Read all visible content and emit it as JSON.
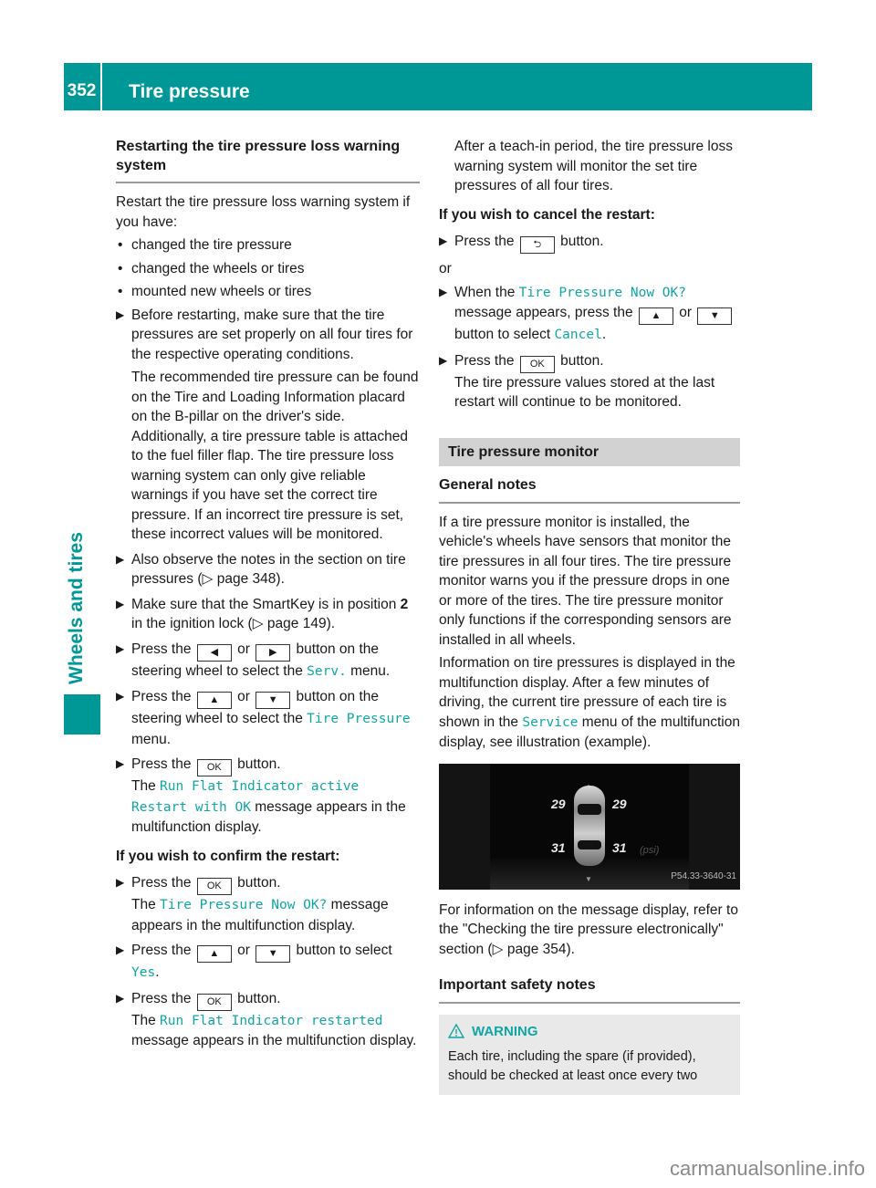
{
  "header": {
    "page_number": "352",
    "title": "Tire pressure"
  },
  "sidebar": {
    "chapter_label": "Wheels and tires",
    "accent_color": "#009896"
  },
  "left": {
    "section_title": "Restarting the tire pressure loss warning system",
    "intro": "Restart the tire pressure loss warning system if you have:",
    "bullets": [
      "changed the tire pressure",
      "changed the wheels or tires",
      "mounted new wheels or tires"
    ],
    "step1": {
      "text": "Before restarting, make sure that the tire pressures are set properly on all four tires for the respective operating conditions.",
      "note": "The recommended tire pressure can be found on the Tire and Loading Information placard on the B-pillar on the driver's side. Additionally, a tire pressure table is attached to the fuel filler flap. The tire pressure loss warning system can only give reliable warnings if you have set the correct tire pressure. If an incorrect tire pressure is set, these incorrect values will be monitored."
    },
    "step2": {
      "text": "Also observe the notes in the section on tire pressures (",
      "ref": "page 348",
      "tail": ")."
    },
    "step3": {
      "pre": "Make sure that the SmartKey is in position ",
      "bold": "2",
      "mid": " in the ignition lock (",
      "ref": "page 149",
      "tail": ")."
    },
    "step4": {
      "pre": "Press the",
      "key1": "◀",
      "or": "or",
      "key2": "▶",
      "mid": "button on the steering wheel to select the",
      "mono": "Serv.",
      "tail": "menu."
    },
    "step5": {
      "pre": "Press the",
      "key1": "▲",
      "or": "or",
      "key2": "▼",
      "mid": "button on the steering wheel to select the",
      "mono": "Tire Pressure",
      "tail": "menu."
    },
    "step6": {
      "pre": "Press the",
      "key": "OK",
      "tail": "button.",
      "line2_pre": "The",
      "mono": "Run Flat Indicator active Restart with OK",
      "line2_tail": "message appears in the multifunction display."
    },
    "confirm_heading": "If you wish to confirm the restart:",
    "confirm_step1": {
      "pre": "Press the",
      "key": "OK",
      "tail": "button.",
      "line2_pre": "The",
      "mono": "Tire Pressure Now OK?",
      "line2_tail": "message appears in the multifunction display."
    },
    "confirm_step2": {
      "pre": "Press the",
      "key1": "▲",
      "or": "or",
      "key2": "▼",
      "mid": "button to select",
      "mono": "Yes",
      "tail": "."
    },
    "confirm_step3": {
      "pre": "Press the",
      "key": "OK",
      "tail": "button.",
      "line2_pre": "The",
      "mono": "Run Flat Indicator restarted",
      "line2_tail": "message appears in the multifunction display."
    }
  },
  "right": {
    "teach_in": "After a teach-in period, the tire pressure loss warning system will monitor the set tire pressures of all four tires.",
    "cancel_heading": "If you wish to cancel the restart:",
    "cancel_step1": {
      "pre": "Press the",
      "key": "⮌",
      "tail": "button."
    },
    "or_label": "or",
    "cancel_step2": {
      "pre": "When the",
      "mono1": "Tire Pressure Now OK?",
      "mid1": "message appears, press the",
      "key1": "▲",
      "or": "or",
      "key2": "▼",
      "mid2": "button to select",
      "mono2": "Cancel",
      "tail": "."
    },
    "cancel_step3": {
      "pre": "Press the",
      "key": "OK",
      "tail": "button.",
      "line2": "The tire pressure values stored at the last restart will continue to be monitored."
    },
    "band_title": "Tire pressure monitor",
    "general_heading": "General notes",
    "general_p1": "If a tire pressure monitor is installed, the vehicle's wheels have sensors that monitor the tire pressures in all four tires. The tire pressure monitor warns you if the pressure drops in one or more of the tires. The tire pressure monitor only functions if the corresponding sensors are installed in all wheels.",
    "general_p2_pre": "Information on tire pressures is displayed in the multifunction display. After a few minutes of driving, the current tire pressure of each tire is shown in the",
    "general_p2_mono": "Service",
    "general_p2_tail": "menu of the multifunction display, see illustration (example).",
    "figure": {
      "front_left": "29",
      "front_right": "29",
      "rear_left": "31",
      "rear_right": "31",
      "unit": "(psi)",
      "code": "P54.33-3640-31"
    },
    "message_ref_pre": "For information on the message display, refer to the \"Checking the tire pressure electronically\" section (",
    "message_ref_page": "page 354",
    "message_ref_tail": ").",
    "safety_heading": "Important safety notes",
    "warning_title": "WARNING",
    "warning_text": "Each tire, including the spare (if provided), should be checked at least once every two"
  },
  "watermark": "carmanualsonline.info"
}
